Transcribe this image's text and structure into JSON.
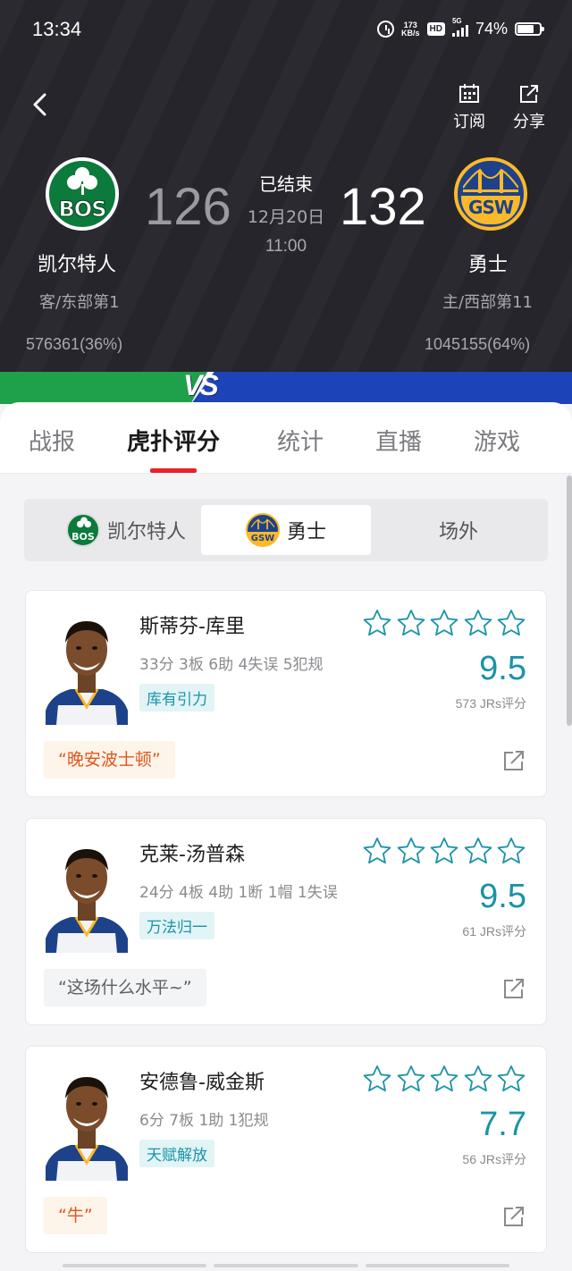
{
  "status_bar": {
    "time": "13:34",
    "net_speed": "173",
    "net_unit": "KB/s",
    "hd": "HD",
    "network": "5G",
    "battery": "74%"
  },
  "header": {
    "subscribe_label": "订阅",
    "share_label": "分享",
    "game_status": "已结束",
    "date": "12月20日",
    "time": "11:00",
    "away": {
      "logo_text": "BOS",
      "name": "凯尔特人",
      "rank": "客/东部第1",
      "score": "126",
      "support": "576361(36%)"
    },
    "home": {
      "logo_text": "GSW",
      "name": "勇士",
      "rank": "主/西部第11",
      "score": "132",
      "support": "1045155(64%)"
    },
    "vs": "VS",
    "colors": {
      "away": "#1fa04a",
      "home": "#1c44b8"
    }
  },
  "tabs": [
    "战报",
    "虎扑评分",
    "统计",
    "直播",
    "游戏"
  ],
  "active_tab": "虎扑评分",
  "segments": [
    "凯尔特人",
    "勇士",
    "场外"
  ],
  "active_segment": "勇士",
  "players": [
    {
      "name": "斯蒂芬-库里",
      "stats": "33分 3板 6助 4失误 5犯规",
      "tag": "库有引力",
      "rating": "9.5",
      "count": "573 JRs评分",
      "quote": "“晚安波士顿”",
      "quote_style": "orange"
    },
    {
      "name": "克莱-汤普森",
      "stats": "24分 4板 4助 1断 1帽 1失误",
      "tag": "万法归一",
      "rating": "9.5",
      "count": "61 JRs评分",
      "quote": "“这场什么水平~”",
      "quote_style": "gray"
    },
    {
      "name": "安德鲁-威金斯",
      "stats": "6分 7板 1助 1犯规",
      "tag": "天赋解放",
      "rating": "7.7",
      "count": "56 JRs评分",
      "quote": "“牛”",
      "quote_style": "orange"
    }
  ]
}
